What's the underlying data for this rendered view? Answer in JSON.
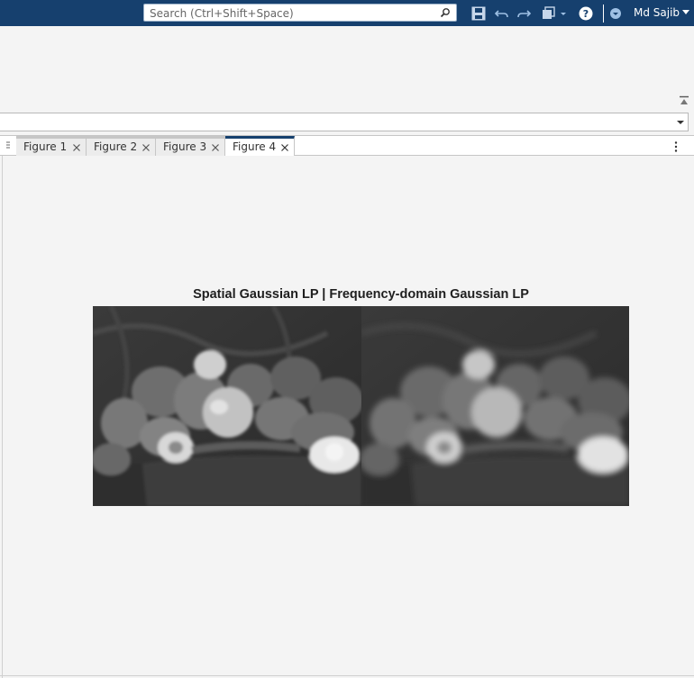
{
  "topbar": {
    "search_placeholder": "Search (Ctrl+Shift+Space)",
    "user_name": "Md Sajib",
    "accent_color": "#16406e"
  },
  "tabs": [
    {
      "label": "Figure 1",
      "active": false
    },
    {
      "label": "Figure 2",
      "active": false
    },
    {
      "label": "Figure 3",
      "active": false
    },
    {
      "label": "Figure 4",
      "active": true
    }
  ],
  "figure": {
    "title": "Spatial Gaussian LP | Frequency-domain Gaussian LP",
    "panels": [
      {
        "name": "spatial-gaussian-lp-image",
        "blur": "moderate"
      },
      {
        "name": "frequency-gaussian-lp-image",
        "blur": "strong"
      }
    ]
  },
  "icons": [
    "search-icon",
    "save-icon",
    "undo-icon",
    "redo-icon",
    "window-layout-icon",
    "help-icon",
    "notification-icon",
    "collapse-toolstrip-icon",
    "dropdown-icon",
    "grip-icon",
    "close-icon",
    "more-options-icon"
  ]
}
